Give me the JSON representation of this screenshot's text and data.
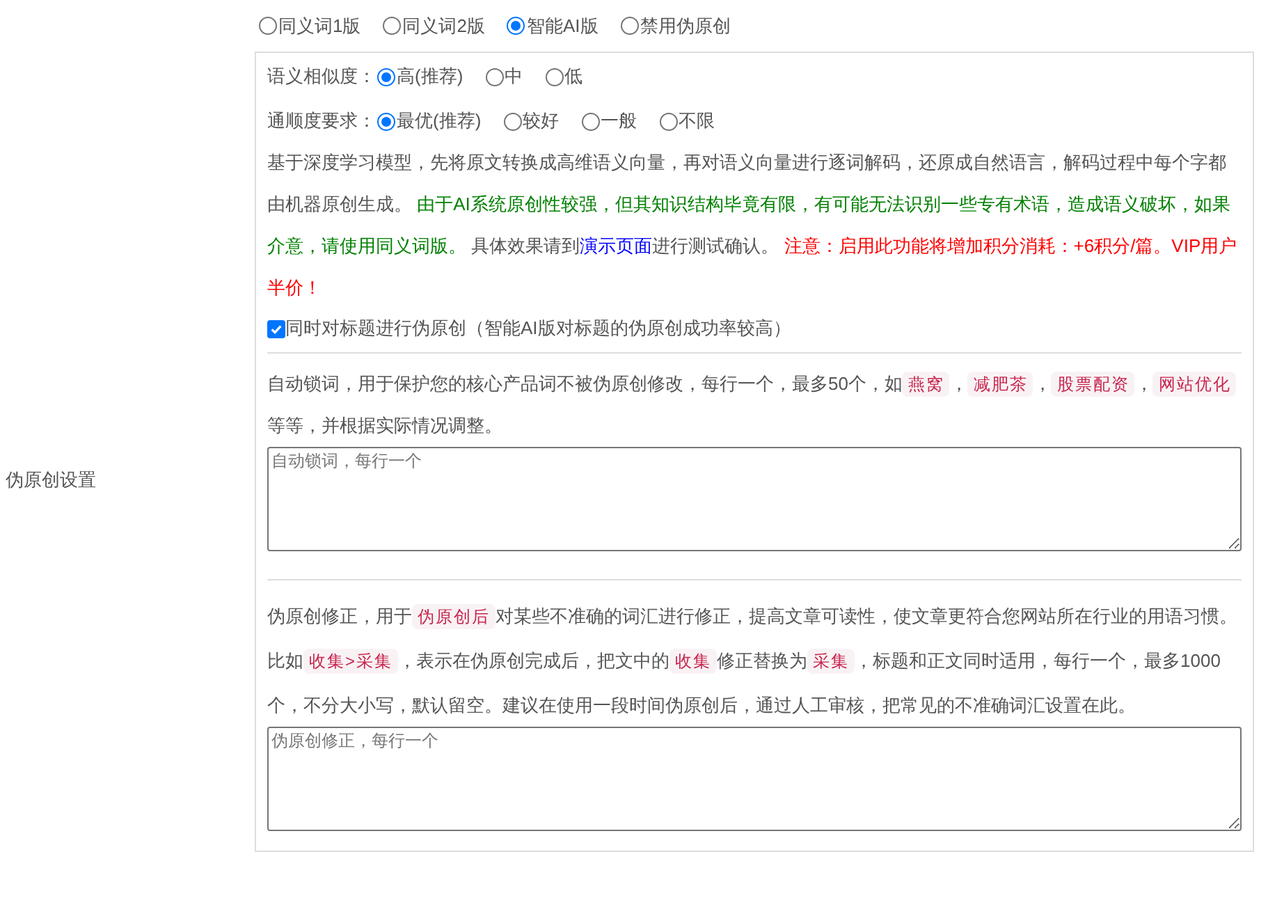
{
  "mode_options": [
    {
      "label": "同义词1版",
      "selected": false
    },
    {
      "label": "同义词2版",
      "selected": false
    },
    {
      "label": "智能AI版",
      "selected": true
    },
    {
      "label": "禁用伪原创",
      "selected": false
    }
  ],
  "section_label": "伪原创设置",
  "similarity": {
    "label": "语义相似度：",
    "options": [
      {
        "label": "高(推荐)",
        "selected": true
      },
      {
        "label": "中",
        "selected": false
      },
      {
        "label": "低",
        "selected": false
      }
    ]
  },
  "fluency": {
    "label": "通顺度要求：",
    "options": [
      {
        "label": "最优(推荐)",
        "selected": true
      },
      {
        "label": "较好",
        "selected": false
      },
      {
        "label": "一般",
        "selected": false
      },
      {
        "label": "不限",
        "selected": false
      }
    ]
  },
  "description": [
    {
      "kind": "text",
      "text": "基于深度学习模型，先将原文转换成高维语义向量，再对语义向量进行逐词解码，还原成自然语言，解码过程中每个字都由机器原创生成。 "
    },
    {
      "kind": "caution",
      "text": "由于AI系统原创性较强，但其知识结构毕竟有限，有可能无法识别一些专有术语，造成语义破坏，如果介意，请使用同义词版。"
    },
    {
      "kind": "text",
      "text": " 具体效果请到"
    },
    {
      "kind": "link",
      "text": "演示页面"
    },
    {
      "kind": "text",
      "text": "进行测试确认。 "
    },
    {
      "kind": "warning",
      "text": "注意：启用此功能将增加积分消耗：+6积分/篇。VIP用户半价！"
    }
  ],
  "title_option": {
    "label": "同时对标题进行伪原创（智能AI版对标题的伪原创成功率较高）",
    "checked": true
  },
  "lock_words": {
    "segments": [
      {
        "kind": "text",
        "text": "自动锁词，用于保护您的核心产品词不被伪原创修改，每行一个，最多50个，如"
      },
      {
        "kind": "tag",
        "text": "燕窝"
      },
      {
        "kind": "text",
        "text": "，"
      },
      {
        "kind": "tag",
        "text": "减肥茶"
      },
      {
        "kind": "text",
        "text": "，"
      },
      {
        "kind": "tag",
        "text": "股票配资"
      },
      {
        "kind": "text",
        "text": "，"
      },
      {
        "kind": "tag",
        "text": "网站优化"
      },
      {
        "kind": "text",
        "text": " 等等，并根据实际情况调整。"
      }
    ],
    "placeholder": "自动锁词，每行一个"
  },
  "correction": {
    "segments": [
      {
        "kind": "text",
        "text": "伪原创修正，用于"
      },
      {
        "kind": "tag",
        "text": "伪原创后"
      },
      {
        "kind": "text",
        "text": "对某些不准确的词汇进行修正，提高文章可读性，使文章更符合您网站所在行业的用语习惯。比如"
      },
      {
        "kind": "tag",
        "text": "收集>采集"
      },
      {
        "kind": "text",
        "text": "，表示在伪原创完成后，把文中的"
      },
      {
        "kind": "tag",
        "text": "收集"
      },
      {
        "kind": "text",
        "text": "修正替换为"
      },
      {
        "kind": "tag",
        "text": "采集"
      },
      {
        "kind": "text",
        "text": "，标题和正文同时适用，每行一个，最多1000个，不分大小写，默认留空。建议在使用一段时间伪原创后，通过人工审核，把常见的不准确词汇设置在此。"
      }
    ],
    "placeholder": "伪原创修正，每行一个"
  }
}
